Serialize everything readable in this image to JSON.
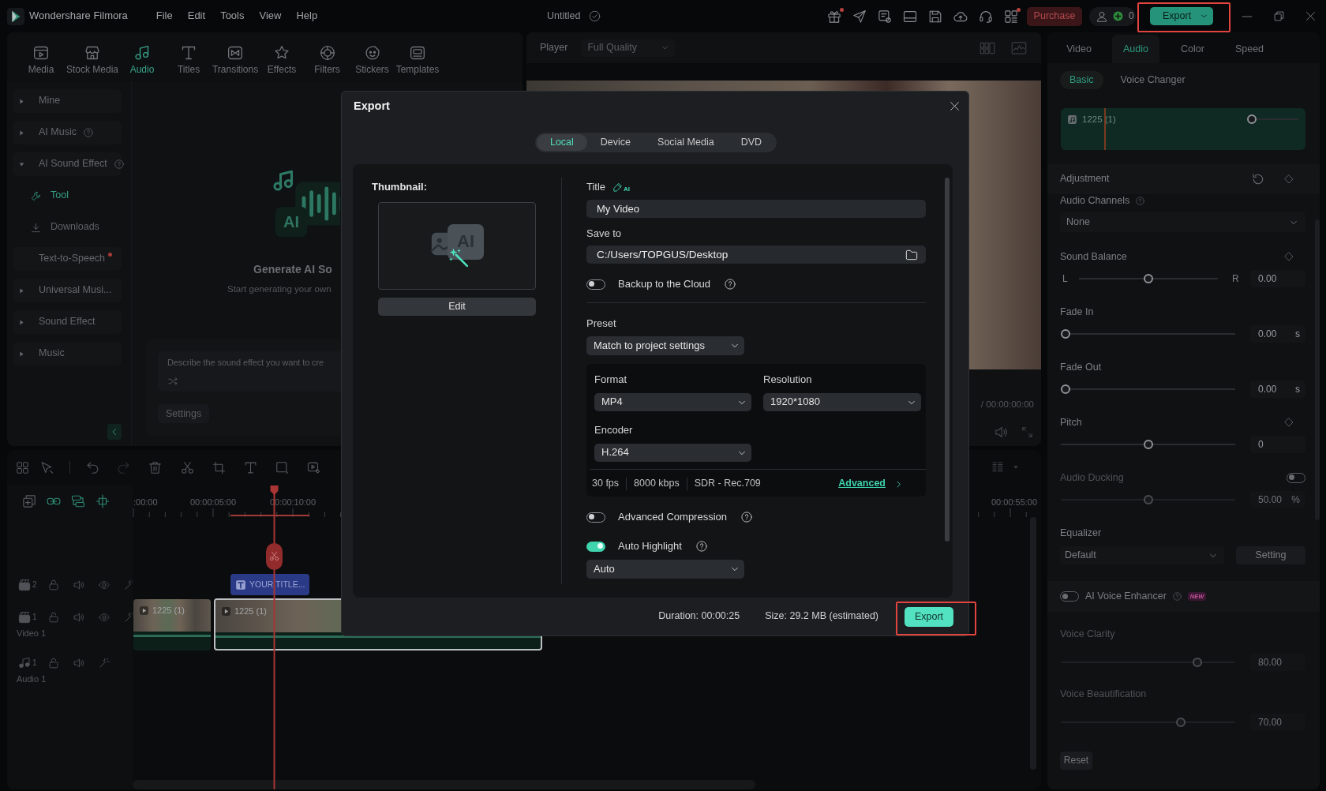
{
  "app": {
    "name": "Wondershare Filmora",
    "menu": [
      "File",
      "Edit",
      "Tools",
      "View",
      "Help"
    ],
    "project": "Untitled",
    "header_icons": [
      {
        "dot": true
      },
      {
        "dot": false
      },
      {
        "dot": false
      },
      {
        "dot": false
      },
      {
        "dot": false
      },
      {
        "dot": false
      },
      {
        "dot": false
      },
      {
        "dot": true
      }
    ],
    "purchase": "Purchase",
    "credits": "0",
    "export": {
      "label": "Export",
      "highlighted": true
    }
  },
  "media_tabs": [
    {
      "label": "Media",
      "selected": false
    },
    {
      "label": "Stock Media",
      "selected": false
    },
    {
      "label": "Audio",
      "selected": true
    },
    {
      "label": "Titles",
      "selected": false
    },
    {
      "label": "Transitions",
      "selected": false
    },
    {
      "label": "Effects",
      "selected": false
    },
    {
      "label": "Filters",
      "selected": false
    },
    {
      "label": "Stickers",
      "selected": false
    },
    {
      "label": "Templates",
      "selected": false
    }
  ],
  "sidebar": {
    "items": [
      {
        "kind": "group",
        "label": "Mine",
        "expanded": false,
        "help": false,
        "dot": false
      },
      {
        "kind": "group",
        "label": "AI Music",
        "expanded": false,
        "help": true,
        "dot": false
      },
      {
        "kind": "group",
        "label": "AI Sound Effect",
        "expanded": true,
        "help": true,
        "dot": false,
        "children": [
          {
            "kind": "tool",
            "label": "Tool",
            "selected": true
          },
          {
            "kind": "download",
            "label": "Downloads",
            "selected": false
          }
        ]
      },
      {
        "kind": "entry",
        "label": "Text-to-Speech",
        "help": false,
        "dot": true
      },
      {
        "kind": "group",
        "label": "Universal Musi...",
        "expanded": false,
        "help": false,
        "dot": false
      },
      {
        "kind": "group",
        "label": "Sound Effect",
        "expanded": false,
        "help": false,
        "dot": false
      },
      {
        "kind": "group",
        "label": "Music",
        "expanded": false,
        "help": false,
        "dot": false
      }
    ]
  },
  "generator": {
    "badge": "AI",
    "title": "Generate AI So",
    "subtitle": "Start generating your own",
    "prompt": {
      "placeholder": "Describe the sound effect you want to cre"
    },
    "settings": "Settings"
  },
  "player": {
    "label": "Player",
    "quality": "Full Quality",
    "timecode": "/ 00:00:00:00"
  },
  "timeline": {
    "ruler": [
      ":00:00",
      "00:00:05:00",
      "00:00:10:00",
      "00:00:55:00"
    ],
    "tracks": [
      {
        "kind": "video",
        "number": "2",
        "clips": [
          {
            "kind": "title",
            "label": "YOUR TITLE...",
            "selected": false
          }
        ]
      },
      {
        "kind": "video",
        "number": "1",
        "name": "Video 1",
        "clips": [
          {
            "kind": "video",
            "label": "1225 (1)",
            "selected": false
          },
          {
            "kind": "video",
            "label": "1225 (1)",
            "selected": true
          }
        ]
      },
      {
        "kind": "audio",
        "number": "1",
        "name": "Audio 1"
      }
    ]
  },
  "properties": {
    "tabs": [
      {
        "label": "Video",
        "selected": false
      },
      {
        "label": "Audio",
        "selected": true
      },
      {
        "label": "Color",
        "selected": false
      },
      {
        "label": "Speed",
        "selected": false
      }
    ],
    "subtabs": [
      {
        "label": "Basic",
        "selected": true
      },
      {
        "label": "Voice Changer",
        "selected": false
      }
    ],
    "clip": {
      "name": "1225 (1)",
      "volume": {
        "level": 0
      }
    },
    "section": "Adjustment",
    "channels": {
      "label": "Audio Channels",
      "value": "None"
    },
    "controls": [
      {
        "kind": "slider",
        "label": "Sound Balance",
        "keyframe": true,
        "left": "L",
        "right": "R",
        "level": 0.5,
        "value": "0.00",
        "disabled": false
      },
      {
        "kind": "slider",
        "label": "Fade In",
        "keyframe": false,
        "level": 0,
        "value": "0.00",
        "unit": "s",
        "disabled": false
      },
      {
        "kind": "slider",
        "label": "Fade Out",
        "keyframe": false,
        "level": 0,
        "value": "0.00",
        "unit": "s",
        "disabled": false
      },
      {
        "kind": "slider",
        "label": "Pitch",
        "keyframe": true,
        "level": 0.5,
        "value": "0",
        "disabled": false
      },
      {
        "kind": "switch_slider",
        "label": "Audio Ducking",
        "on": false,
        "level": 0.5,
        "value": "50.00",
        "unit": "%",
        "disabled": true
      }
    ],
    "equalizer": {
      "label": "Equalizer",
      "value": "Default",
      "button": "Setting"
    },
    "enhancer": {
      "label": "AI Voice Enhancer",
      "on": false,
      "badge": "NEW"
    },
    "enhancer_controls": [
      {
        "label": "Voice Clarity",
        "level": 0.8,
        "value": "80.00",
        "disabled": true
      },
      {
        "label": "Voice Beautification",
        "level": 0.7,
        "value": "70.00",
        "disabled": true
      }
    ],
    "reset": "Reset"
  },
  "export_dialog": {
    "title": "Export",
    "tabs": [
      {
        "label": "Local",
        "selected": true
      },
      {
        "label": "Device",
        "selected": false
      },
      {
        "label": "Social Media",
        "selected": false
      },
      {
        "label": "DVD",
        "selected": false
      }
    ],
    "thumbnail": {
      "label": "Thumbnail:",
      "badge": "AI",
      "edit": "Edit"
    },
    "video_title": {
      "label": "Title",
      "badge": "AI",
      "value": "My Video"
    },
    "save_to": {
      "label": "Save to",
      "value": "C:/Users/TOPGUS/Desktop"
    },
    "backup": {
      "label": "Backup to the Cloud",
      "on": false
    },
    "preset": {
      "label": "Preset",
      "value": "Match to project settings"
    },
    "format": {
      "label": "Format",
      "value": "MP4"
    },
    "resolution": {
      "label": "Resolution",
      "value": "1920*1080"
    },
    "encoder": {
      "label": "Encoder",
      "value": "H.264"
    },
    "specs": [
      "30 fps",
      "8000 kbps",
      "SDR - Rec.709"
    ],
    "advanced": "Advanced",
    "compression": {
      "label": "Advanced Compression",
      "on": false
    },
    "auto_highlight": {
      "label": "Auto Highlight",
      "on": true,
      "mode": "Auto"
    },
    "duration": "Duration: 00:00:25",
    "size": "Size: 29.2 MB (estimated)",
    "export": {
      "label": "Export",
      "highlighted": true
    }
  }
}
